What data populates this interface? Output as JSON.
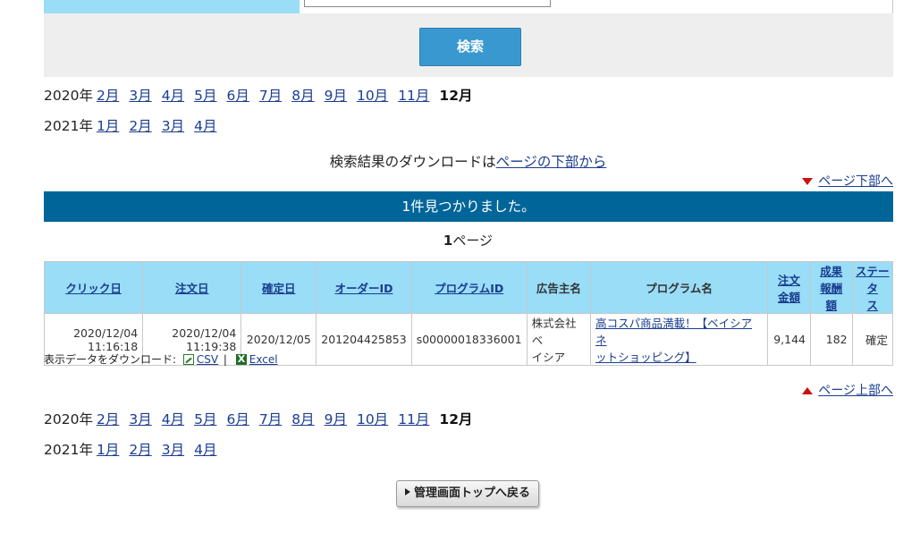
{
  "search": {
    "button_label": "検索"
  },
  "month_nav_top": {
    "rows": [
      {
        "year": "2020年",
        "months": [
          "2月",
          "3月",
          "4月",
          "5月",
          "6月",
          "7月",
          "8月",
          "9月",
          "10月",
          "11月"
        ],
        "current": "12月"
      },
      {
        "year": "2021年",
        "months": [
          "1月",
          "2月",
          "3月",
          "4月"
        ],
        "current": ""
      }
    ]
  },
  "month_nav_bottom": {
    "rows": [
      {
        "year": "2020年",
        "months": [
          "2月",
          "3月",
          "4月",
          "5月",
          "6月",
          "7月",
          "8月",
          "9月",
          "10月",
          "11月"
        ],
        "current": "12月"
      },
      {
        "year": "2021年",
        "months": [
          "1月",
          "2月",
          "3月",
          "4月"
        ],
        "current": ""
      }
    ]
  },
  "download_note": {
    "prefix": "検索結果のダウンロードは",
    "link": "ページの下部から"
  },
  "jump": {
    "to_bottom": "ページ下部へ",
    "to_top": "ページ上部へ"
  },
  "result_banner": "1件見つかりました。",
  "page_indicator": {
    "number": "1",
    "suffix": "ページ"
  },
  "table": {
    "headers": [
      {
        "label": "クリック日",
        "sortable": true
      },
      {
        "label": "注文日",
        "sortable": true
      },
      {
        "label": "確定日",
        "sortable": true
      },
      {
        "label": "オーダーID",
        "sortable": true
      },
      {
        "label": "プログラムID",
        "sortable": true
      },
      {
        "label": "広告主名",
        "sortable": false
      },
      {
        "label": "プログラム名",
        "sortable": false
      },
      {
        "label_lines": [
          "注文",
          "金額"
        ],
        "sortable": true
      },
      {
        "label_lines": [
          "成果",
          "報酬",
          "額"
        ],
        "sortable": true
      },
      {
        "label_lines": [
          "ステー",
          "タ",
          "ス"
        ],
        "sortable": true
      }
    ],
    "rows": [
      {
        "click_date": "2020/12/04",
        "click_time": "11:16:18",
        "order_date": "2020/12/04",
        "order_time": "11:19:38",
        "confirm_date": "2020/12/05",
        "order_id": "201204425853",
        "program_id": "s00000018336001",
        "advertiser_lines": [
          "株式会社ベ",
          "イシア"
        ],
        "program_name_lines": [
          "高コスパ商品満載！【ベイシアネ",
          "ットショッピング】"
        ],
        "order_amount": "9,144",
        "reward": "182",
        "status": "確定"
      }
    ]
  },
  "download": {
    "label": "表示データをダウンロード:",
    "csv": "CSV",
    "separator": "|",
    "excel": "Excel"
  },
  "back_button": "管理画面トップへ戻る",
  "colors": {
    "header_bg": "#99ddf7",
    "banner_bg": "#006699",
    "search_button": "#3a98d0",
    "link": "#1a3d8f",
    "arrow_red": "#cc1111"
  }
}
